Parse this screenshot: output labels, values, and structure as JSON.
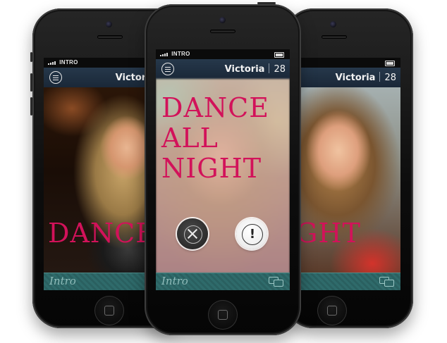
{
  "app": {
    "carrier": "INTRO",
    "profile": {
      "name": "Victoria",
      "age": "28"
    },
    "footer_label": "Intro",
    "colors": {
      "headline": "#d2125a",
      "topbar": "#1f2f40",
      "footer": "#2d6666"
    }
  },
  "left_screen": {
    "overlay_text": "DANCE"
  },
  "center_screen": {
    "headline": [
      "DANCE",
      "ALL",
      "NIGHT"
    ],
    "dismiss_icon": "close-icon",
    "flag_label": "!"
  },
  "right_screen": {
    "overlay_text": "IGHT"
  },
  "icons": {
    "menu": "menu-icon",
    "chat": "chat-bubbles-icon",
    "battery": "battery-icon",
    "signal": "signal-icon"
  }
}
